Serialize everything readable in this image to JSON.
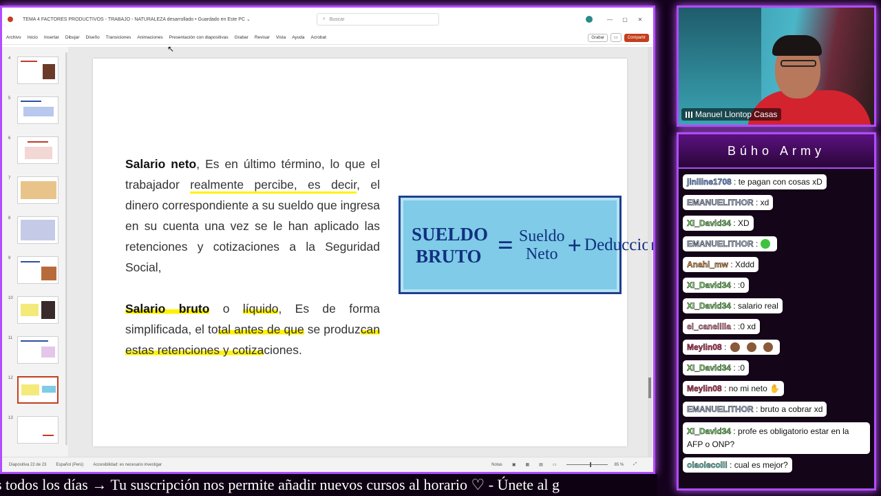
{
  "ppt": {
    "title": "TEMA 4 FACTORES PRODUCTIVOS - TRABAJO - NATURALEZA desarrollado • Guardado en Este PC ⌄",
    "search_placeholder": "Buscar",
    "ribbon_tabs": [
      "Archivo",
      "Inicio",
      "Insertar",
      "Dibujar",
      "Diseño",
      "Transiciones",
      "Animaciones",
      "Presentación con diapositivas",
      "Grabar",
      "Revisar",
      "Vista",
      "Ayuda",
      "Acrobat"
    ],
    "record_label": "Grabar",
    "share_label": "Compartir",
    "thumb_numbers": [
      "4",
      "5",
      "6",
      "7",
      "8",
      "9",
      "10",
      "11",
      "12",
      "13"
    ],
    "status": {
      "slide": "Diapositiva 22 de 23",
      "language": "Español (Perú)",
      "accessibility": "Accesibilidad: es necesario investigar",
      "notes": "Notas",
      "zoom": "85 %"
    }
  },
  "slide": {
    "p1": {
      "bold": "Salario neto",
      "t1": ", Es en último término, lo que el trabajador ",
      "hl": "realmente percibe, es decir",
      "t2": ", el dinero correspondiente a su sueldo que ingresa en su cuenta una vez se le han aplicado las retenciones y cotizaciones a la Seguridad Social,"
    },
    "p2": {
      "bold": "Salario bruto",
      "t1": " o ",
      "hl1": "líquido",
      "t2": ", Es de forma simplificada, el to",
      "hl2": "tal antes de que",
      "t3": " se produz",
      "hl3": "can estas retenciones y cotiza",
      "t4": "ciones."
    },
    "formula": {
      "left_line1": "SUELDO",
      "left_line2": "BRUTO",
      "equals": "=",
      "mid_line1": "Sueldo",
      "mid_line2": "Neto",
      "plus": "+",
      "right": "Deducciones"
    }
  },
  "webcam": {
    "name": "Manuel Llontop Casas"
  },
  "chat": {
    "title": "Búho Army",
    "messages": [
      {
        "user": "jinliine1708",
        "text": ": te pagan con cosas xD",
        "color": "u-blue"
      },
      {
        "user": "EMANUELITHOR",
        "text": ": xd",
        "color": "u-gray"
      },
      {
        "user": "XI_David34",
        "text": ": XD",
        "color": "u-green"
      },
      {
        "user": "EMANUELITHOR",
        "text": ":",
        "color": "u-gray"
      },
      {
        "user": "Anahi_mw",
        "text": ": Xddd",
        "color": "u-orange"
      },
      {
        "user": "XI_David34",
        "text": ": :0",
        "color": "u-green"
      },
      {
        "user": "XI_David34",
        "text": ": salario real",
        "color": "u-green"
      },
      {
        "user": "el_canelilla",
        "text": ": :0 xd",
        "color": "u-pink"
      },
      {
        "user": "Meylin08",
        "text": ":",
        "color": "u-red"
      },
      {
        "user": "XI_David34",
        "text": ": :0",
        "color": "u-green"
      },
      {
        "user": "Meylin08",
        "text": ": no mi neto",
        "color": "u-red"
      },
      {
        "user": "EMANUELITHOR",
        "text": ": bruto a cobrar xd",
        "color": "u-gray"
      },
      {
        "user": "XI_David34",
        "text": ": profe es obligatorio estar en la AFP o ONP?",
        "color": "u-green"
      },
      {
        "user": "olaolecolii",
        "text": ": cual es mejor?",
        "color": "u-teal"
      }
    ]
  },
  "ticker": {
    "text": "s todos los días  →  Tu suscripción nos permite añadir nuevos cursos al horario  ♡   -  Únete al g"
  }
}
